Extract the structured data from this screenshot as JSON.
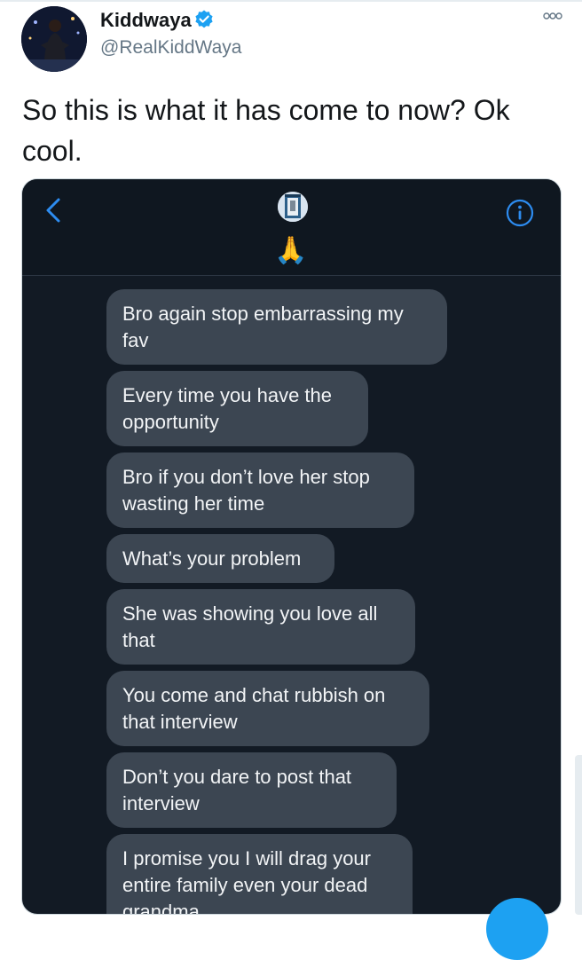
{
  "tweet": {
    "display_name": "Kiddwaya",
    "handle": "@RealKiddWaya",
    "text": "So this is what it has come to now? Ok cool.",
    "verified": true,
    "avatar_icon": "profile-photo",
    "more_icon": "more-options-icon"
  },
  "screenshot": {
    "header": {
      "back_icon": "chevron-left-icon",
      "info_icon": "info-icon",
      "contact_emoji": "🙏"
    },
    "messages": [
      "Bro again stop embarrassing my fav",
      "Every time you have the opportunity",
      "Bro if you don’t love her stop wasting her time",
      "What’s your problem",
      "She was showing you love all that",
      "You come and chat rubbish on that interview",
      "Don’t you dare to post that interview",
      "I promise you I will drag your entire family even your dead grandma"
    ]
  },
  "colors": {
    "accent": "#1da1f2",
    "chat_background": "#121a24",
    "bubble": "#3c4652"
  }
}
